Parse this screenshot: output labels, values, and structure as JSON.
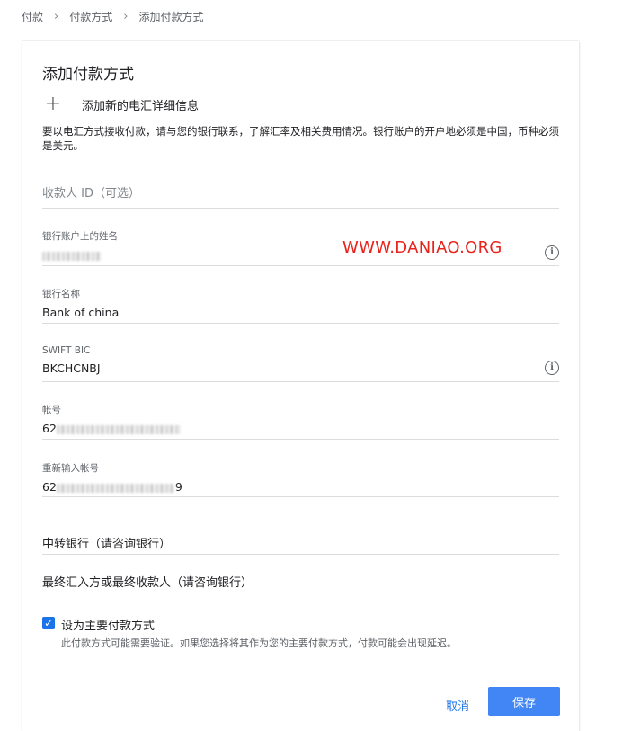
{
  "breadcrumb": {
    "items": [
      "付款",
      "付款方式",
      "添加付款方式"
    ],
    "separator": "›"
  },
  "card": {
    "title": "添加付款方式",
    "add_new": "添加新的电汇详细信息",
    "description": "要以电汇方式接收付款，请与您的银行联系，了解汇率及相关费用情况。银行账户的开户地必须是中国，币种必须是美元。"
  },
  "fields": {
    "payee_id": {
      "placeholder": "收款人 ID（可选）"
    },
    "account_name": {
      "label": "银行账户上的姓名",
      "value": ""
    },
    "bank_name": {
      "label": "银行名称",
      "value": "Bank of china"
    },
    "swift": {
      "label": "SWIFT BIC",
      "value": "BKCHCNBJ"
    },
    "account_number": {
      "label": "帐号",
      "prefix": "62",
      "suffix": ""
    },
    "reenter_account": {
      "label": "重新输入帐号",
      "prefix": "62",
      "suffix": "9"
    },
    "intermediary_bank": {
      "label": "中转银行（请咨询银行）"
    },
    "final_beneficiary": {
      "label": "最终汇入方或最终收款人（请咨询银行）"
    }
  },
  "watermark": "WWW.DANIAO.ORG",
  "primary_checkbox": {
    "checked": true,
    "label": "设为主要付款方式",
    "note": "此付款方式可能需要验证。如果您选择将其作为您的主要付款方式，付款可能会出现延迟。"
  },
  "actions": {
    "cancel": "取消",
    "save": "保存"
  },
  "colors": {
    "primary": "#4285f4",
    "link": "#1a73e8",
    "watermark": "#e8231c",
    "divider": "#dadce0"
  },
  "icons": {
    "add": "plus-icon",
    "info": "info-icon",
    "check": "checkmark-icon"
  }
}
